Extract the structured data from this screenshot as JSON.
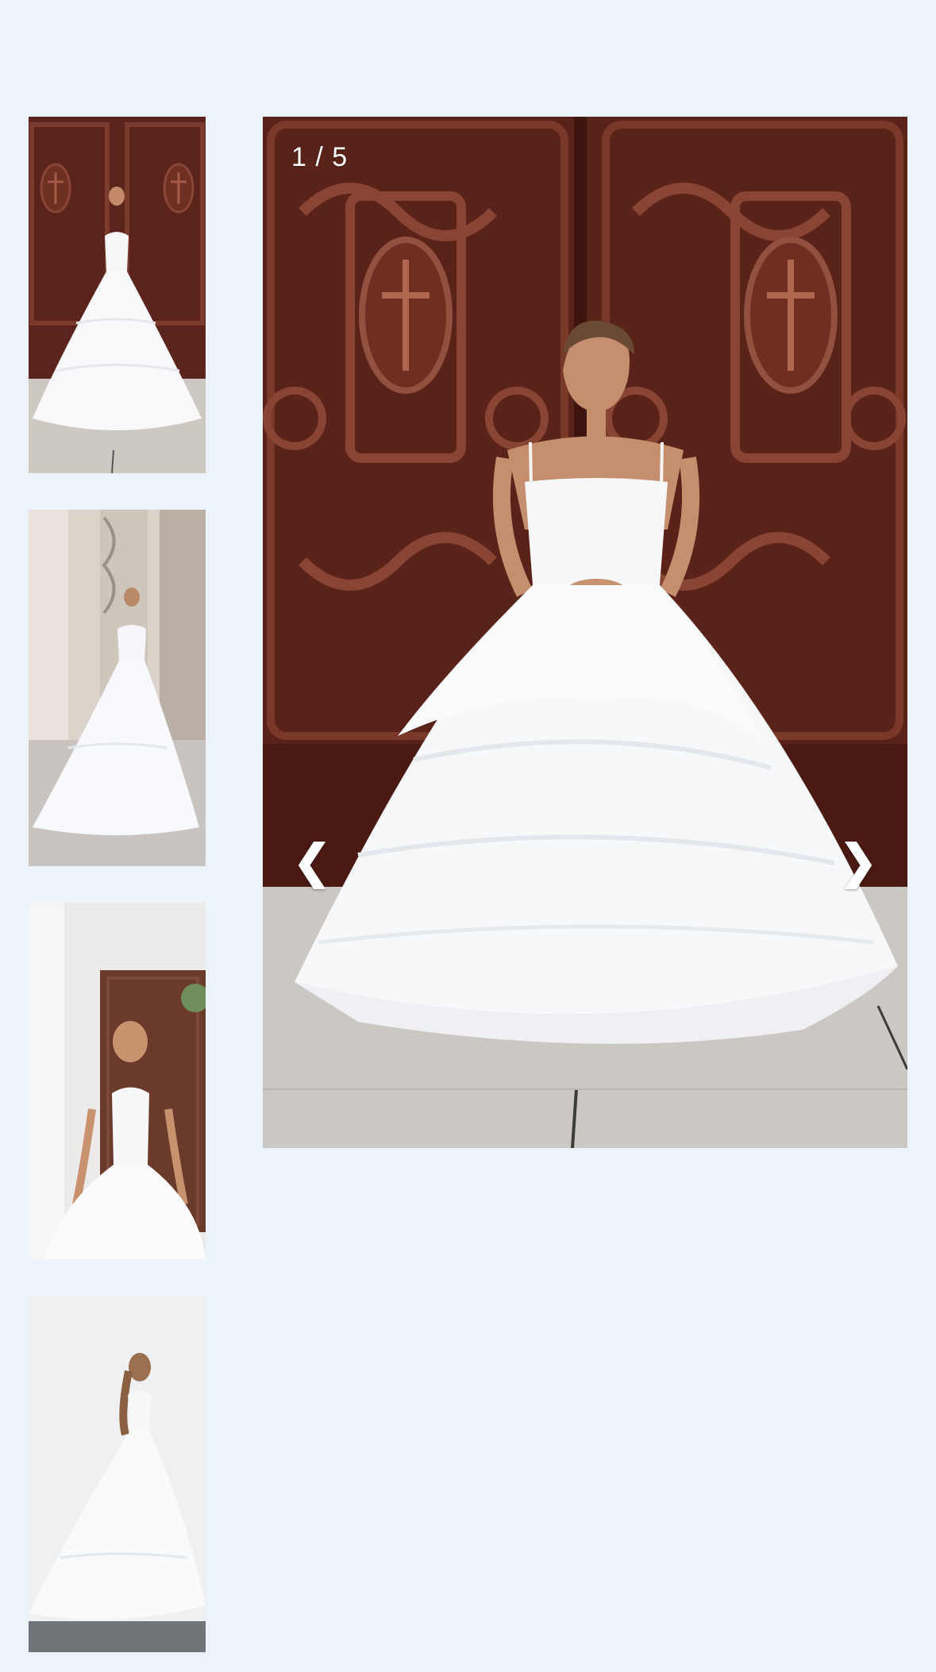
{
  "gallery": {
    "counter": "1 / 5",
    "prev_icon": "❮",
    "next_icon": "❯",
    "thumbnails": [
      {
        "name": "thumbnail-front-carved-door"
      },
      {
        "name": "thumbnail-back-stone-column"
      },
      {
        "name": "thumbnail-front-portrait"
      },
      {
        "name": "thumbnail-back-studio"
      }
    ]
  }
}
